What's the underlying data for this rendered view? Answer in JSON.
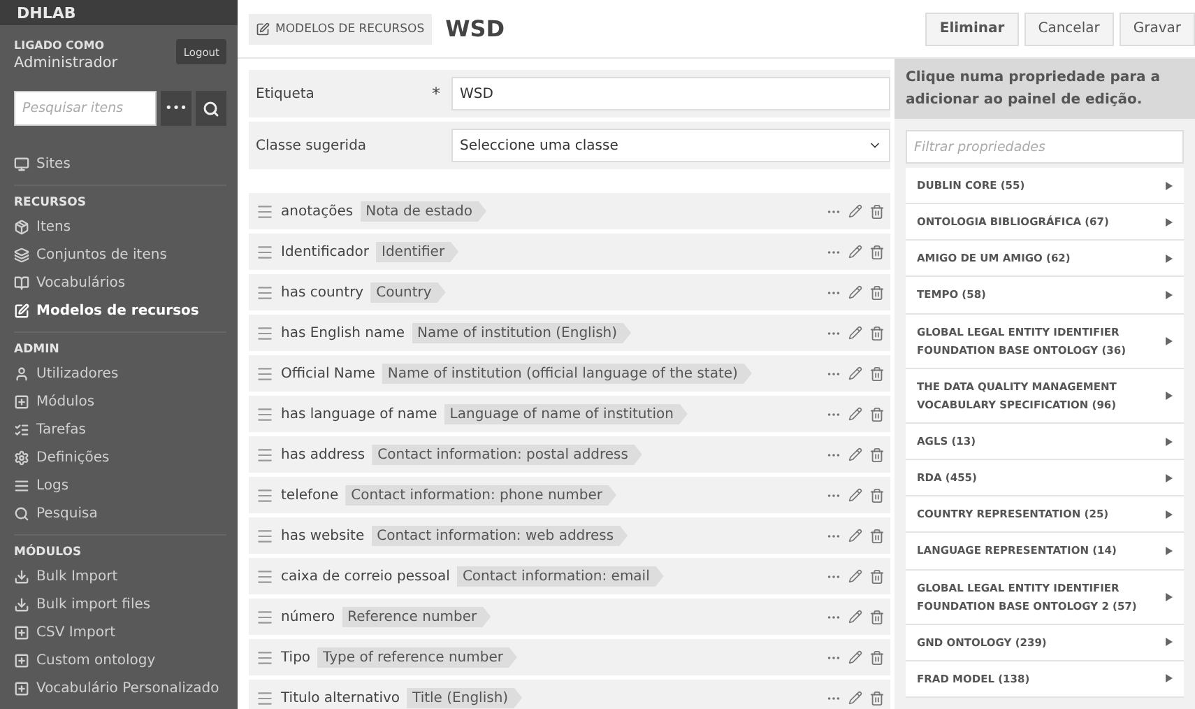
{
  "sidebar": {
    "brand": "DHLAB",
    "user_label": "LIGADO COMO",
    "user_name": "Administrador",
    "logout": "Logout",
    "search": {
      "placeholder": "Pesquisar itens"
    },
    "advanced_button": "•••",
    "sections": [
      {
        "items": [
          {
            "label": "Sites",
            "selected": false
          }
        ]
      },
      {
        "heading": "RECURSOS",
        "items": [
          {
            "label": "Itens",
            "selected": false
          },
          {
            "label": "Conjuntos de itens",
            "selected": false
          },
          {
            "label": "Vocabulários",
            "selected": false
          },
          {
            "label": "Modelos de recursos",
            "selected": true
          }
        ]
      },
      {
        "heading": "ADMIN",
        "items": [
          {
            "label": "Utilizadores",
            "selected": false
          },
          {
            "label": "Módulos",
            "selected": false
          },
          {
            "label": "Tarefas",
            "selected": false
          },
          {
            "label": "Definições",
            "selected": false
          },
          {
            "label": "Logs",
            "selected": false
          },
          {
            "label": "Pesquisa",
            "selected": false
          }
        ]
      },
      {
        "heading": "MÓDULOS",
        "items": [
          {
            "label": "Bulk Import",
            "selected": false
          },
          {
            "label": "Bulk import files",
            "selected": false
          },
          {
            "label": "CSV Import",
            "selected": false
          },
          {
            "label": "Custom ontology",
            "selected": false
          },
          {
            "label": "Vocabulário Personalizado",
            "selected": false
          }
        ]
      }
    ]
  },
  "header": {
    "breadcrumb": "MODELOS DE RECURSOS",
    "title": "WSD",
    "buttons": [
      "Eliminar",
      "Cancelar",
      "Gravar"
    ]
  },
  "form": {
    "label_field": {
      "label": "Etiqueta",
      "required_mark": "*",
      "value": "WSD"
    },
    "class_field": {
      "label": "Classe sugerida",
      "value": "Seleccione uma classe"
    }
  },
  "properties": [
    {
      "name": "anotações",
      "alt_label": "Nota de estado"
    },
    {
      "name": "Identificador",
      "alt_label": "Identifier"
    },
    {
      "name": "has country",
      "alt_label": "Country"
    },
    {
      "name": "has English name",
      "alt_label": "Name of institution (English)"
    },
    {
      "name": "Official Name",
      "alt_label": "Name of institution (official language of the state)"
    },
    {
      "name": "has language of name",
      "alt_label": "Language of name of institution"
    },
    {
      "name": "has address",
      "alt_label": "Contact information: postal address"
    },
    {
      "name": "telefone",
      "alt_label": "Contact information: phone number"
    },
    {
      "name": "has website",
      "alt_label": "Contact information: web address"
    },
    {
      "name": "caixa de correio pessoal",
      "alt_label": "Contact information: email"
    },
    {
      "name": "número",
      "alt_label": "Reference number"
    },
    {
      "name": "Tipo",
      "alt_label": "Type of reference number"
    },
    {
      "name": "Titulo alternativo",
      "alt_label": "Title (English)"
    }
  ],
  "property_panel": {
    "hint": "Clique numa propriedade para a adicionar ao painel de edição.",
    "filter": {
      "placeholder": "Filtrar propriedades"
    },
    "vocabularies": [
      {
        "label": "DUBLIN CORE (55)",
        "expanded": false
      },
      {
        "label": "ONTOLOGIA BIBLIOGRÁFICA (67)",
        "expanded": false
      },
      {
        "label": "AMIGO DE UM AMIGO (62)",
        "expanded": false
      },
      {
        "label": "TEMPO (58)",
        "expanded": false
      },
      {
        "label": "GLOBAL LEGAL ENTITY IDENTIFIER FOUNDATION BASE ONTOLOGY (36)",
        "expanded": false
      },
      {
        "label": "THE DATA QUALITY MANAGEMENT VOCABULARY SPECIFICATION (96)",
        "expanded": false
      },
      {
        "label": "AGLS (13)",
        "expanded": false
      },
      {
        "label": "RDA (455)",
        "expanded": false
      },
      {
        "label": "COUNTRY REPRESENTATION (25)",
        "expanded": false
      },
      {
        "label": "LANGUAGE REPRESENTATION (14)",
        "expanded": false
      },
      {
        "label": "GLOBAL LEGAL ENTITY IDENTIFIER FOUNDATION BASE ONTOLOGY 2 (57)",
        "expanded": false
      },
      {
        "label": "GND ONTOLOGY (239)",
        "expanded": false
      },
      {
        "label": "FRAD MODEL (138)",
        "expanded": false
      }
    ]
  }
}
